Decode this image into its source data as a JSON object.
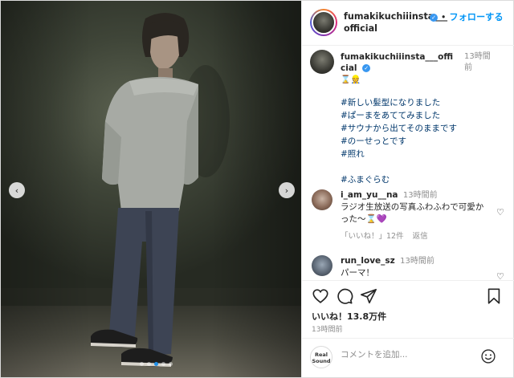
{
  "photo": {
    "prev_label": "‹",
    "next_label": "›",
    "slide_count": 5,
    "active_slide": 2
  },
  "header": {
    "username": "fumakikuchiiinsta___official",
    "separator": "•",
    "follow_label": "フォローする"
  },
  "caption": {
    "username": "fumakikuchiiinsta___official",
    "time": "13時間前",
    "emoji": "⌛️👷",
    "lines": [
      "#新しい髪型になりました",
      "#ぱーまをあててみました",
      "#サウナから出てそのままです",
      "#のーせっとです",
      "#照れ"
    ],
    "tag": "#ふまぐらむ"
  },
  "comments": [
    {
      "username": "i_am_yu__na",
      "time": "13時間前",
      "text": "ラジオ生放送の写真ふわふわで可愛かった〜⌛️💜",
      "likes": "「いいね！」12件",
      "reply": "返信"
    },
    {
      "username": "run_love_sz",
      "time": "13時間前",
      "text": "パーマ！"
    }
  ],
  "actions": {
    "likes": "いいね！13.8万件",
    "posted": "13時間前"
  },
  "comment_box": {
    "logo_text": "Real Sound",
    "placeholder": "コメントを追加..."
  }
}
